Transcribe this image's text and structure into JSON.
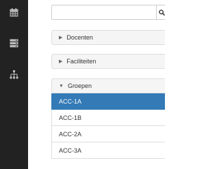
{
  "rail": {
    "icons": [
      "calendar-icon",
      "server-icon",
      "sitemap-icon"
    ]
  },
  "search": {
    "value": "",
    "placeholder": "",
    "button_icon": "search-icon"
  },
  "panels": [
    {
      "label": "Docenten",
      "state": "collapsed"
    },
    {
      "label": "Faciliteiten",
      "state": "collapsed"
    },
    {
      "label": "Groepen",
      "state": "expanded"
    }
  ],
  "groups": {
    "items": [
      "ACC-1A",
      "ACC-1B",
      "ACC-2A",
      "ACC-3A"
    ],
    "selected": "ACC-1A"
  },
  "colors": {
    "rail": "#222222",
    "selected": "#337ab7",
    "panel_header": "#f5f5f5"
  }
}
